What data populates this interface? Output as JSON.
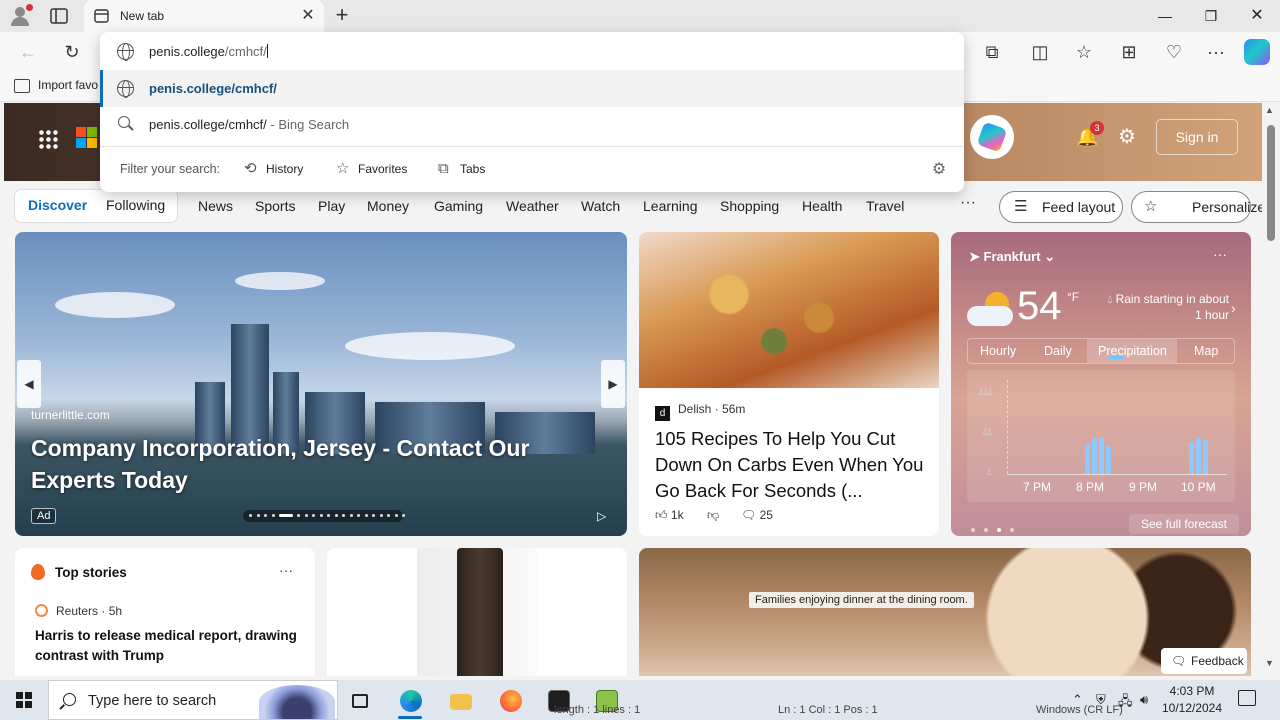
{
  "browser": {
    "tab_title": "New tab",
    "close_tab": "✕",
    "new_tab": "+",
    "window": {
      "minimize": "—",
      "maximize": "❐",
      "close": "✕"
    },
    "toolbar": {
      "back": "←",
      "reload": "↻",
      "more": "···"
    },
    "bookmarks": {
      "import_label": "Import favo"
    }
  },
  "omnibox": {
    "typed_host": "penis.college",
    "typed_path": "/cmhcf/",
    "suggestion_url": "penis.college/cmhcf/",
    "search_query": "penis.college/cmhcf/",
    "search_suffix": " - Bing Search",
    "filter_label": "Filter your search:",
    "filters": [
      "History",
      "Favorites",
      "Tabs"
    ]
  },
  "header": {
    "notifications_count": "3",
    "signin_label": "Sign in"
  },
  "nav": {
    "discover": "Discover",
    "following": "Following",
    "items": [
      "News",
      "Sports",
      "Play",
      "Money",
      "Gaming",
      "Weather",
      "Watch",
      "Learning",
      "Shopping",
      "Health",
      "Travel"
    ],
    "more": "···",
    "feed_layout": "Feed layout",
    "personalize": "Personalize"
  },
  "hero": {
    "source": "turnerlittle.com",
    "title": "Company Incorporation, Jersey - Contact Our Experts Today",
    "ad_label": "Ad",
    "slide_index": 4,
    "slide_count": 20
  },
  "recipe": {
    "source": "Delish",
    "source_logo": "d",
    "age": "56m",
    "title": "105 Recipes To Help You Cut Down On Carbs Even When You Go Back For Seconds (...",
    "likes": "1k",
    "comments": "25"
  },
  "weather": {
    "location": "Frankfurt",
    "temperature": "54",
    "unit": "°F",
    "description": "Rain starting in about 1 hour",
    "tabs": [
      "Hourly",
      "Daily",
      "Precipitation",
      "Map"
    ],
    "active_tab": "Precipitation",
    "times": [
      "7 PM",
      "8 PM",
      "9 PM",
      "10 PM"
    ],
    "forecast_link": "See full forecast",
    "more": "···"
  },
  "top_stories": {
    "title": "Top stories",
    "more": "···",
    "source": "Reuters",
    "age": "5h",
    "headline": "Harris to release medical report, drawing contrast with Trump"
  },
  "dining": {
    "caption": "Families enjoying dinner at the dining room.",
    "feedback": "Feedback"
  },
  "taskbar": {
    "search_placeholder": "Type here to search",
    "time": "4:03 PM",
    "date": "10/12/2024",
    "behind_text_1": "length : 1  lines : 1",
    "behind_text_2": "Ln : 1   Col : 1   Pos : 1",
    "behind_text_3": "Windows (CR LF)"
  },
  "colors": {
    "accent": "#0f6cbd",
    "badge": "#d13438"
  }
}
